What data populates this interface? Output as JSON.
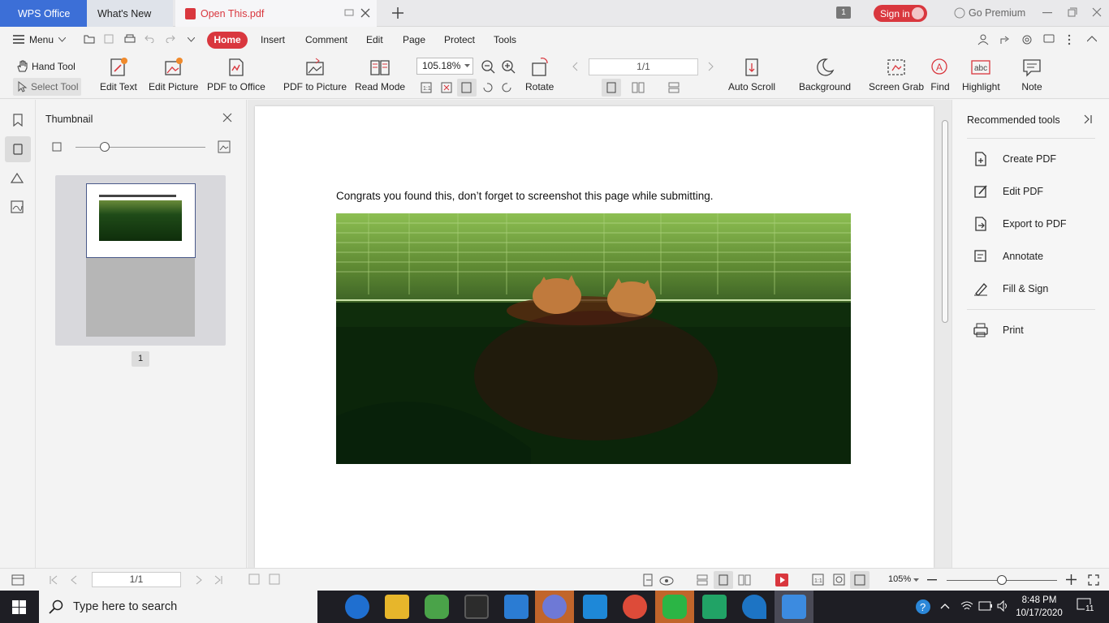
{
  "titlebar": {
    "tabs": [
      "WPS Office",
      "What's New",
      "Open This.pdf"
    ],
    "badge": "1",
    "signin": "Sign in",
    "premium": "Go Premium"
  },
  "menu": {
    "menu_label": "Menu",
    "tabs": [
      "Home",
      "Insert",
      "Comment",
      "Edit",
      "Page",
      "Protect",
      "Tools"
    ]
  },
  "ribbon": {
    "hand_tool": "Hand Tool",
    "select_tool": "Select Tool",
    "edit_text": "Edit Text",
    "edit_picture": "Edit Picture",
    "pdf_to_office": "PDF to Office",
    "pdf_to_picture": "PDF to Picture",
    "read_mode": "Read Mode",
    "zoom": "105.18%",
    "rotate": "Rotate",
    "page_indicator": "1/1",
    "auto_scroll": "Auto Scroll",
    "background": "Background",
    "screen_grab": "Screen Grab",
    "find": "Find",
    "highlight": "Highlight",
    "note": "Note"
  },
  "thumbnail": {
    "title": "Thumbnail",
    "page_number": "1"
  },
  "document": {
    "text": "Congrats you found this, don’t forget to screenshot this page while submitting."
  },
  "right_panel": {
    "title": "Recommended tools",
    "items": [
      "Create PDF",
      "Edit PDF",
      "Export to PDF",
      "Annotate",
      "Fill & Sign",
      "Print"
    ]
  },
  "statusbar": {
    "page": "1/1",
    "zoom": "105%"
  },
  "taskbar": {
    "search_placeholder": "Type here to search",
    "time": "8:48 PM",
    "date": "10/17/2020",
    "notifications": "11"
  },
  "colors": {
    "accent_red": "#d9373e",
    "wps_blue": "#3c6fd7"
  }
}
